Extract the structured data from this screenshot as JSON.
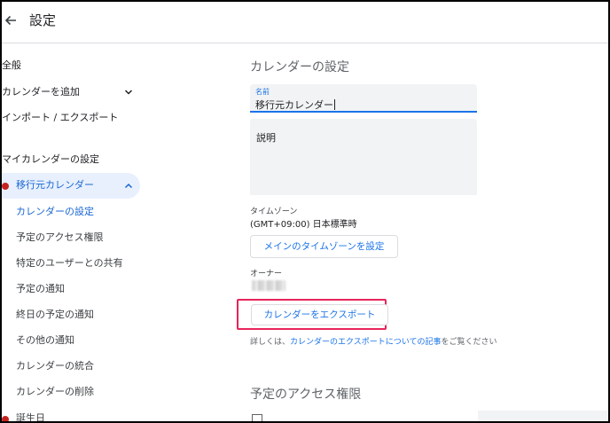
{
  "header": {
    "back_icon": "arrow-left-icon",
    "title": "設定"
  },
  "sidebar": {
    "general": "全般",
    "add_calendar": "カレンダーを追加",
    "import_export": "インポート / エクスポート",
    "my_calendars_heading": "マイカレンダーの設定",
    "active_calendar": "移行元カレンダー",
    "sub_items": [
      "カレンダーの設定",
      "予定のアクセス権限",
      "特定のユーザーとの共有",
      "予定の通知",
      "終日の予定の通知",
      "その他の通知",
      "カレンダーの統合",
      "カレンダーの削除"
    ],
    "birthdays": "誕生日",
    "calendar_color": "#c5221f",
    "active_bg": "#e8f0fe"
  },
  "main": {
    "section_title": "カレンダーの設定",
    "name_label": "名前",
    "name_value": "移行元カレンダー",
    "description_label": "説明",
    "timezone_label": "タイムゾーン",
    "timezone_value": "(GMT+09:00) 日本標準時",
    "timezone_button": "メインのタイムゾーンを設定",
    "owner_label": "オーナー",
    "export_button": "カレンダーをエクスポート",
    "help_prefix": "詳しくは、",
    "help_link": "カレンダーのエクスポートについての記事",
    "help_suffix": "をご覧ください",
    "access_section_title": "予定のアクセス権限",
    "accent_color": "#1a73e8",
    "highlight_color": "#e8245a"
  }
}
